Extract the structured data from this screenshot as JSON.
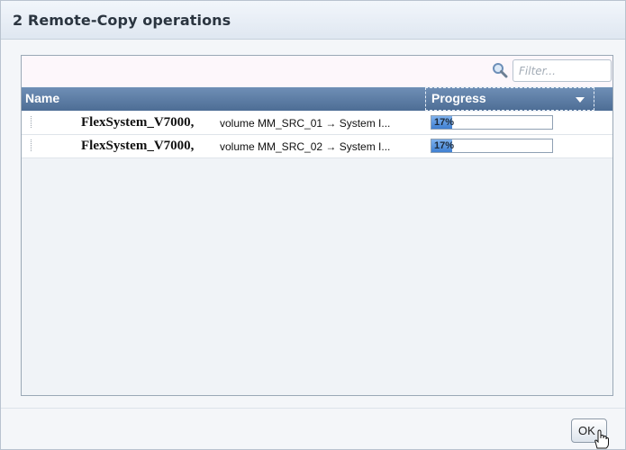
{
  "dialog": {
    "title": "2 Remote-Copy operations"
  },
  "filter": {
    "placeholder": "Filter...",
    "icon": "search-icon"
  },
  "table": {
    "columns": {
      "name": "Name",
      "progress": "Progress"
    },
    "rows": [
      {
        "system": "FlexSystem_V7000,",
        "description": "volume MM_SRC_01 → System I...",
        "progress_text": "17%",
        "progress_value": 0.17
      },
      {
        "system": "FlexSystem_V7000,",
        "description": "volume MM_SRC_02 → System I...",
        "progress_text": "17%",
        "progress_value": 0.17
      }
    ]
  },
  "footer": {
    "ok_label": "OK"
  },
  "colors": {
    "header_bg": "#5b7ba3",
    "progress_fill": "#4a88d8"
  }
}
